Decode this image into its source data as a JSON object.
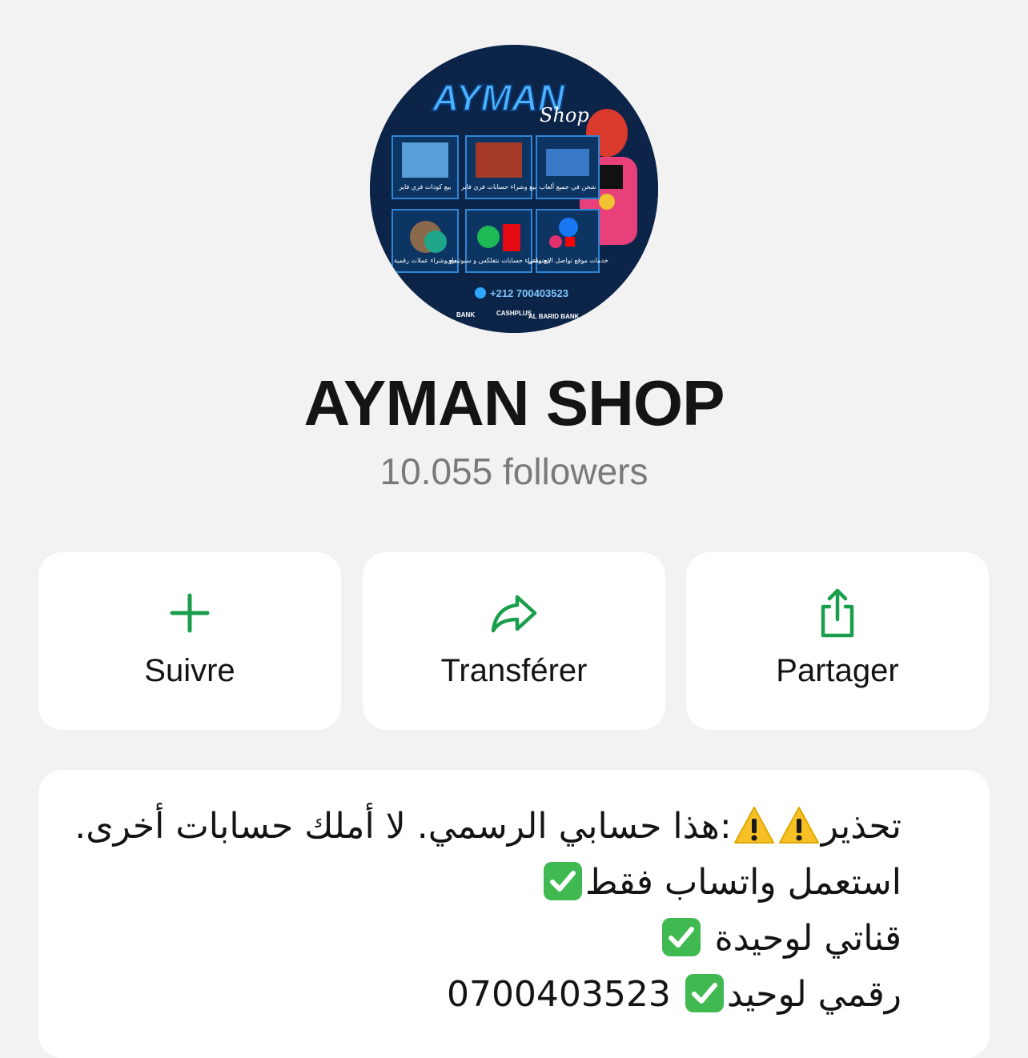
{
  "channel": {
    "name": "AYMAN SHOP",
    "followers": "10.055 followers"
  },
  "avatar_art": {
    "brand_main": "AYMAN",
    "brand_sub": "Shop",
    "phone": "+212 700403523",
    "tiles": [
      "بيع كودات فري فاير",
      "بيع وشراء حسابات فري فاير",
      "شحن في جميع ألعاب",
      "بيع وشراء عملات رقمية",
      "بيع وشراء حسابات نتفلكس و سبوتيفاي",
      "خدمات موقع تواصل الاجتماعي"
    ],
    "banks": [
      "BANK",
      "CASHPLUS",
      "AL BARID BANK"
    ]
  },
  "actions": [
    {
      "label": "Suivre",
      "icon": "plus-icon"
    },
    {
      "label": "Transférer",
      "icon": "forward-arrow-icon"
    },
    {
      "label": "Partager",
      "icon": "share-icon"
    }
  ],
  "description": {
    "line1_a": "تحذير",
    "line1_b": ":هذا حسابي الرسمي. لا أملك حسابات أخرى.",
    "line2": "استعمل واتساب فقط",
    "line3": "قناتي لوحيدة",
    "line4_a": "رقمي لوحيد",
    "line4_b": "0700403523"
  },
  "colors": {
    "accent": "#1a9e4b",
    "background": "#f2f2f2",
    "card": "#ffffff",
    "text": "#141414",
    "muted": "#7a7a7a"
  }
}
